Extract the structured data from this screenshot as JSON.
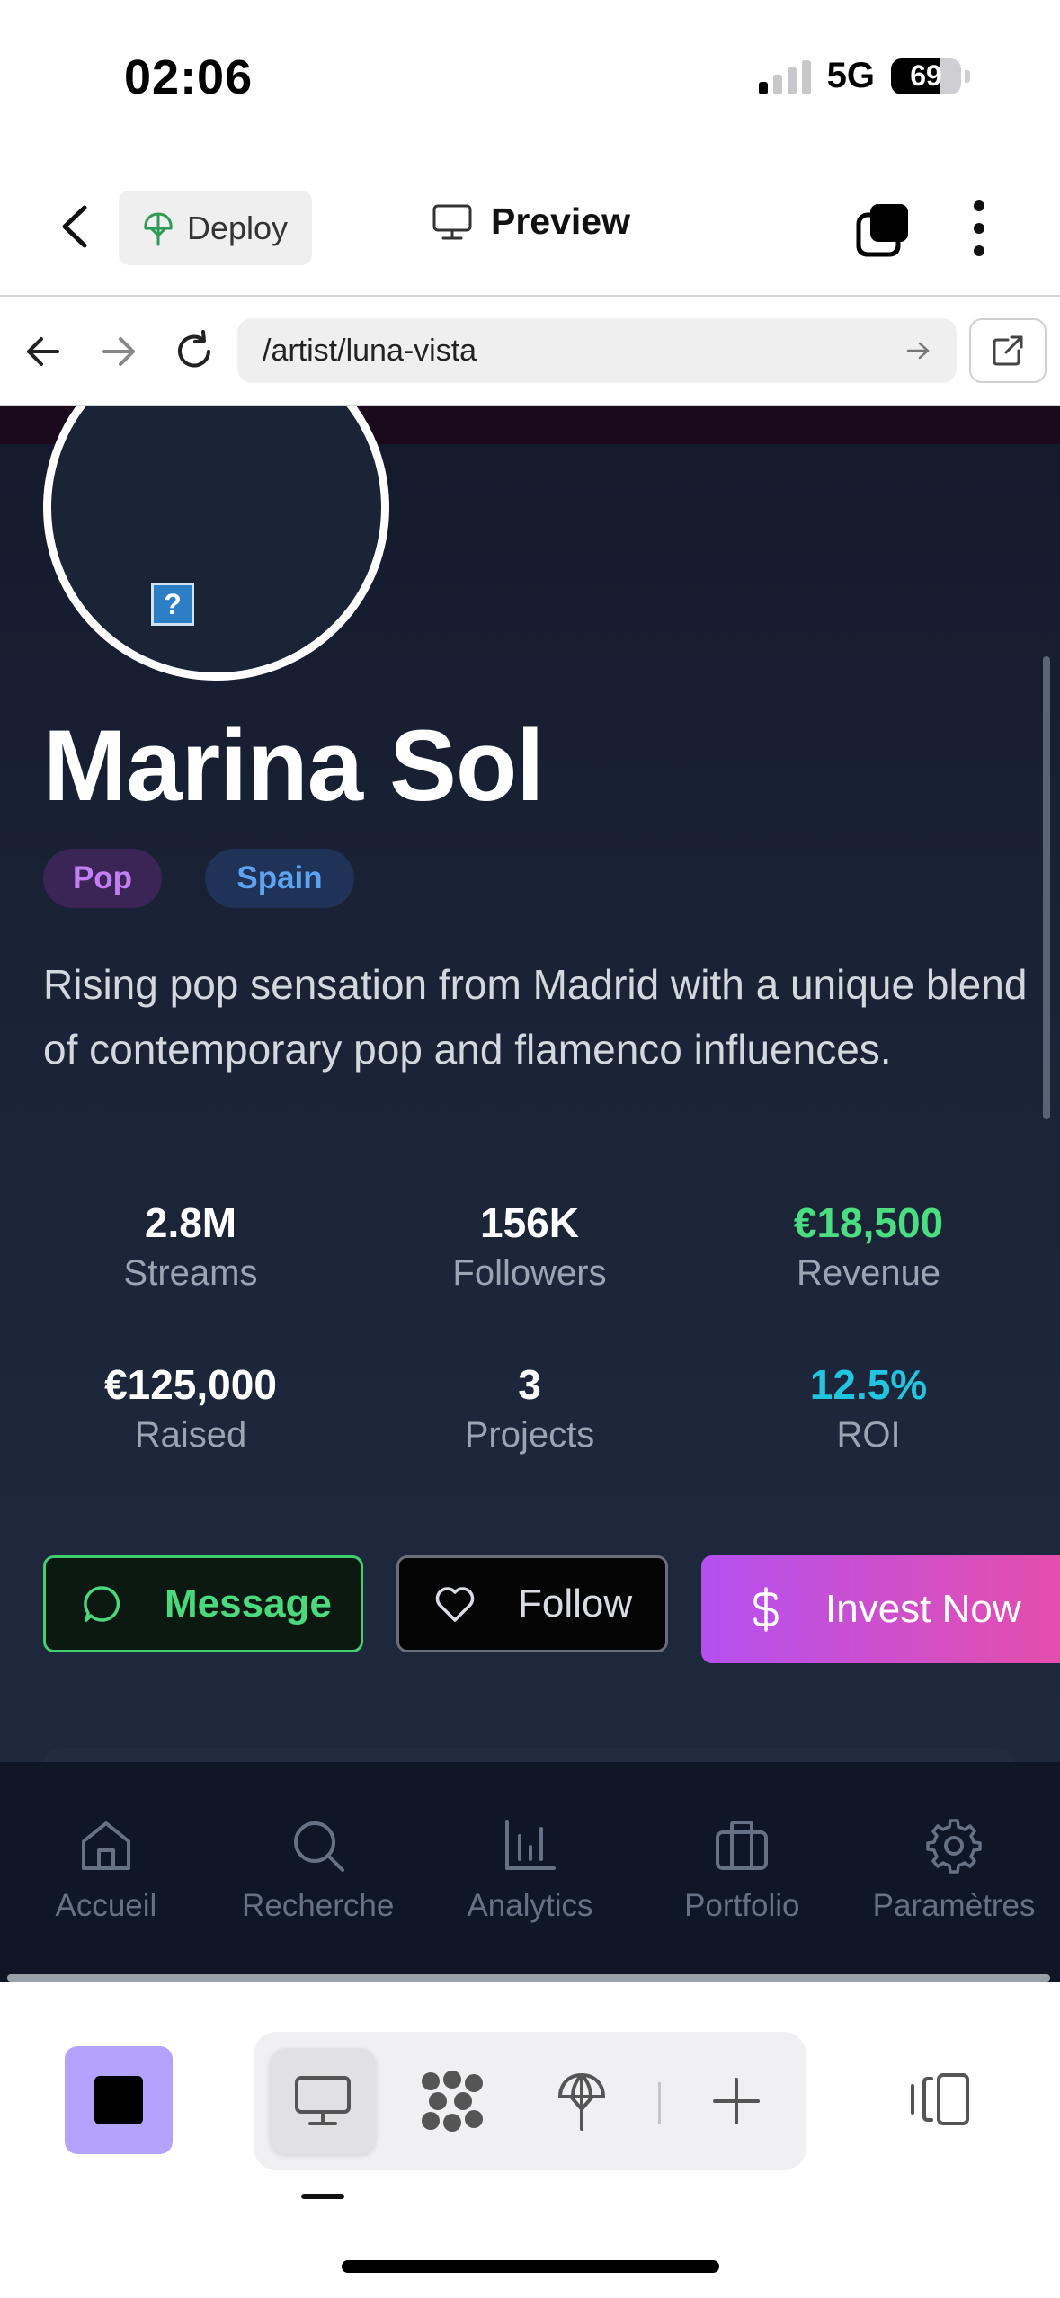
{
  "status_bar": {
    "time": "02:06",
    "network": "5G",
    "battery": "69",
    "battery_level": 0.69,
    "signal_bars_on": 1
  },
  "header": {
    "deploy_label": "Deploy",
    "title": "Preview"
  },
  "browser": {
    "url": "/artist/luna-vista"
  },
  "artist": {
    "name": "Marina Sol",
    "tags": [
      "Pop",
      "Spain"
    ],
    "bio": "Rising pop sensation from Madrid with a unique blend of contemporary pop and flamenco influences.",
    "avatar_placeholder": "?"
  },
  "stats": [
    {
      "value": "2.8M",
      "label": "Streams",
      "color": "#ffffff"
    },
    {
      "value": "156K",
      "label": "Followers",
      "color": "#ffffff"
    },
    {
      "value": "€18,500",
      "label": "Revenue",
      "color": "#4ade80"
    },
    {
      "value": "€125,000",
      "label": "Raised",
      "color": "#ffffff"
    },
    {
      "value": "3",
      "label": "Projects",
      "color": "#ffffff"
    },
    {
      "value": "12.5%",
      "label": "ROI",
      "color": "#22c5e0"
    }
  ],
  "actions": {
    "message": "Message",
    "follow": "Follow",
    "invest": "Invest Now"
  },
  "bottom_nav": [
    {
      "label": "Accueil",
      "icon": "home-icon"
    },
    {
      "label": "Recherche",
      "icon": "search-icon"
    },
    {
      "label": "Analytics",
      "icon": "bar-chart-icon"
    },
    {
      "label": "Portfolio",
      "icon": "briefcase-icon"
    },
    {
      "label": "Paramètres",
      "icon": "gear-icon"
    }
  ],
  "colors": {
    "accent_green": "#4ade80",
    "accent_cyan": "#22c5e0",
    "invest_gradient_start": "#b450f0",
    "invest_gradient_end": "#e84ea8",
    "app_square": "#b3a3ff"
  }
}
